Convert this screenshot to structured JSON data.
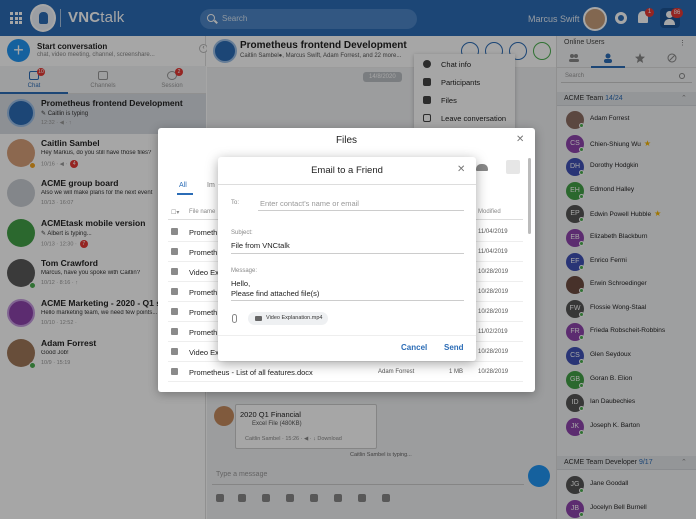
{
  "app": {
    "brand": "VNC",
    "brand_suffix": "talk",
    "search_placeholder": "Search",
    "user_name": "Marcus Swift",
    "bell_badge": "1",
    "person_badge": "86"
  },
  "left": {
    "start_title": "Start conversation",
    "start_sub": "chat, video meeting, channel, screenshare...",
    "tabs": [
      {
        "label": "Chat",
        "badge": "10"
      },
      {
        "label": "Channels",
        "badge": ""
      },
      {
        "label": "Session",
        "badge": "2"
      }
    ],
    "conversations": [
      {
        "name": "Prometheus frontend Development",
        "msg": "✎ Caitlin is typing",
        "time": "12:32 · ◀ · ↑",
        "badge": ""
      },
      {
        "name": "Caitlin Sambel",
        "msg": "Hey Markus, do you still have those files?",
        "time": "10/16 · ◀ ·",
        "badge": "4"
      },
      {
        "name": "ACME group board",
        "msg": "Also we will make plans for the next event",
        "time": "10/13 · 16:07",
        "badge": ""
      },
      {
        "name": "ACMEtask mobile version",
        "msg": "✎ Albert is typing...",
        "time": "10/13 · 12:30 ·",
        "badge": "7"
      },
      {
        "name": "Tom Crawford",
        "msg": "Marcus, have you spoke with Caitlin?",
        "time": "10/12 · 8:16 · ↑",
        "badge": ""
      },
      {
        "name": "ACME Marketing - 2020 - Q1 strategy",
        "msg": "Hello marketing team, we need few points...",
        "time": "10/10 · 12:52 ·",
        "badge": ""
      },
      {
        "name": "Adam Forrest",
        "msg": "Good Job!",
        "time": "10/9 · 15:19",
        "badge": ""
      }
    ]
  },
  "chat": {
    "title": "Prometheus frontend Development",
    "participants": "Caitlin Sambel●, Marcus Swift, Adam Forrest, and 22 more...",
    "date": "14/8/2020",
    "file_card_title": "2020 Q1 Financial",
    "file_card_sub": "Excel File (480KB)",
    "file_card_meta": "Caitlin Sambel · 15:26 · ◀ · ↓ Download",
    "typing": "Caitlin Sambel is typing...",
    "compose_placeholder": "Type a message"
  },
  "context_menu": [
    "Chat info",
    "Participants",
    "Files",
    "Leave conversation"
  ],
  "right": {
    "title": "Online Users",
    "search_placeholder": "Search",
    "group1": {
      "name": "ACME Team",
      "count": "14/24"
    },
    "members1": [
      {
        "name": "Adam Forrest",
        "initials": "",
        "color": "#8d6e63",
        "star": false
      },
      {
        "name": "Chien-Shiung Wu",
        "initials": "CS",
        "color": "#8e44ad",
        "star": true
      },
      {
        "name": "Dorothy Hodgkin",
        "initials": "DH",
        "color": "#3f51b5",
        "star": false
      },
      {
        "name": "Edmond Halley",
        "initials": "EH",
        "color": "#43a047",
        "star": false
      },
      {
        "name": "Edwin Powell Hubble",
        "initials": "EP",
        "color": "#555555",
        "star": true
      },
      {
        "name": "Elizabeth Blackburn",
        "initials": "EB",
        "color": "#8e44ad",
        "star": false
      },
      {
        "name": "Enrico Fermi",
        "initials": "EF",
        "color": "#3f51b5",
        "star": false
      },
      {
        "name": "Erwin Schroedinger",
        "initials": "",
        "color": "#6d4c41",
        "star": false
      },
      {
        "name": "Flossie Wong-Staal",
        "initials": "FW",
        "color": "#555555",
        "star": false
      },
      {
        "name": "Frieda Robscheit-Robbins",
        "initials": "FR",
        "color": "#8e44ad",
        "star": false
      },
      {
        "name": "Glen Seydoux",
        "initials": "CS",
        "color": "#3f51b5",
        "star": false
      },
      {
        "name": "Goran B. Elion",
        "initials": "GB",
        "color": "#43a047",
        "star": false
      },
      {
        "name": "Ian Daubechies",
        "initials": "ID",
        "color": "#555555",
        "star": false
      },
      {
        "name": "Joseph K. Barton",
        "initials": "JK",
        "color": "#8e44ad",
        "star": false
      }
    ],
    "group2": {
      "name": "ACME Team Developer",
      "count": "9/17"
    },
    "members2": [
      {
        "name": "Jane Goodall",
        "initials": "JG",
        "color": "#555555",
        "star": false
      },
      {
        "name": "Jocelyn Bell Burnell",
        "initials": "JB",
        "color": "#8e44ad",
        "star": false
      }
    ]
  },
  "files_dialog": {
    "title": "Files",
    "tabs": [
      "All",
      "Im"
    ],
    "headers": {
      "name": "File name",
      "modified": "Modified"
    },
    "rows": [
      {
        "name": "Prometh",
        "owner": "",
        "size": "",
        "date": "11/04/2019"
      },
      {
        "name": "Prometh",
        "owner": "",
        "size": "",
        "date": "11/04/2019"
      },
      {
        "name": "Video Ex",
        "owner": "",
        "size": "",
        "date": "10/28/2019"
      },
      {
        "name": "Prometh",
        "owner": "",
        "size": "",
        "date": "10/28/2019"
      },
      {
        "name": "Prometh",
        "owner": "",
        "size": "",
        "date": "10/28/2019"
      },
      {
        "name": "Prometh",
        "owner": "",
        "size": "",
        "date": "11/02/2019"
      },
      {
        "name": "Video Ex",
        "owner": "",
        "size": "",
        "date": "10/28/2019"
      },
      {
        "name": "Prometheus - List of all features.docx",
        "owner": "Adam Forrest",
        "size": "1 MB",
        "date": "10/28/2019"
      }
    ]
  },
  "email_dialog": {
    "title": "Email to a Friend",
    "to_label": "To:",
    "to_placeholder": "Enter contact's name or email",
    "subject_label": "Subject:",
    "subject_value": "File from VNCtalk",
    "message_label": "Message:",
    "message_value": "Hello,\nPlease find attached file(s)",
    "attachment": "Video Explanation.mp4",
    "cancel": "Cancel",
    "send": "Send"
  }
}
